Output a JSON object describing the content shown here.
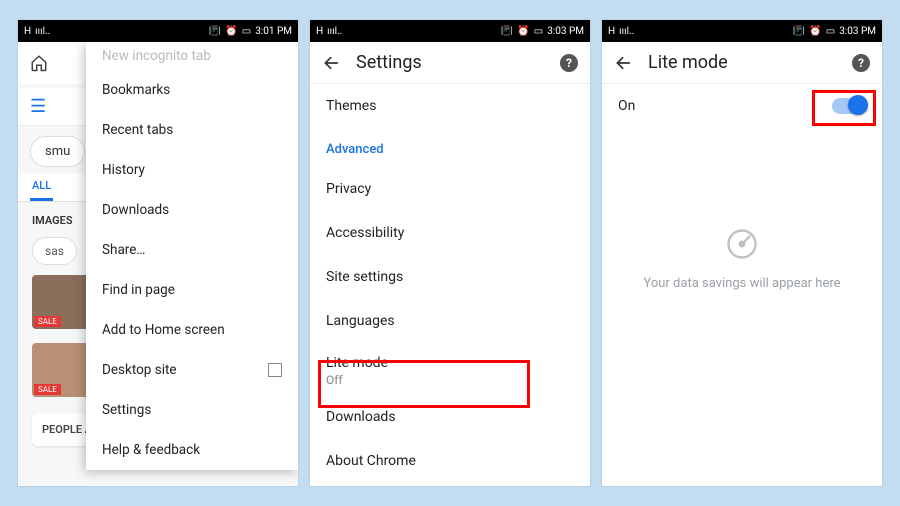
{
  "statusbar": {
    "network": "H",
    "signal": "ıııl..",
    "time1": "3:01 PM",
    "time2": "3:03 PM",
    "time3": "3:03 PM"
  },
  "screen1": {
    "incognito": "New incognito tab",
    "menu": {
      "bookmarks": "Bookmarks",
      "recent": "Recent tabs",
      "history": "History",
      "downloads": "Downloads",
      "share": "Share…",
      "find": "Find in page",
      "addhome": "Add to Home screen",
      "desktop": "Desktop site",
      "settings": "Settings",
      "help": "Help & feedback"
    },
    "chip": "smu",
    "tabs": {
      "all": "ALL"
    },
    "images": "IMAGES",
    "chip2": "sas",
    "people": "PEOPLE ALSO ASK"
  },
  "screen2": {
    "title": "Settings",
    "items": {
      "themes": "Themes",
      "advanced": "Advanced",
      "privacy": "Privacy",
      "accessibility": "Accessibility",
      "site": "Site settings",
      "languages": "Languages",
      "lite": "Lite mode",
      "lite_sub": "Off",
      "downloads": "Downloads",
      "about": "About Chrome"
    }
  },
  "screen3": {
    "title": "Lite mode",
    "on": "On",
    "msg": "Your data savings will appear here"
  }
}
